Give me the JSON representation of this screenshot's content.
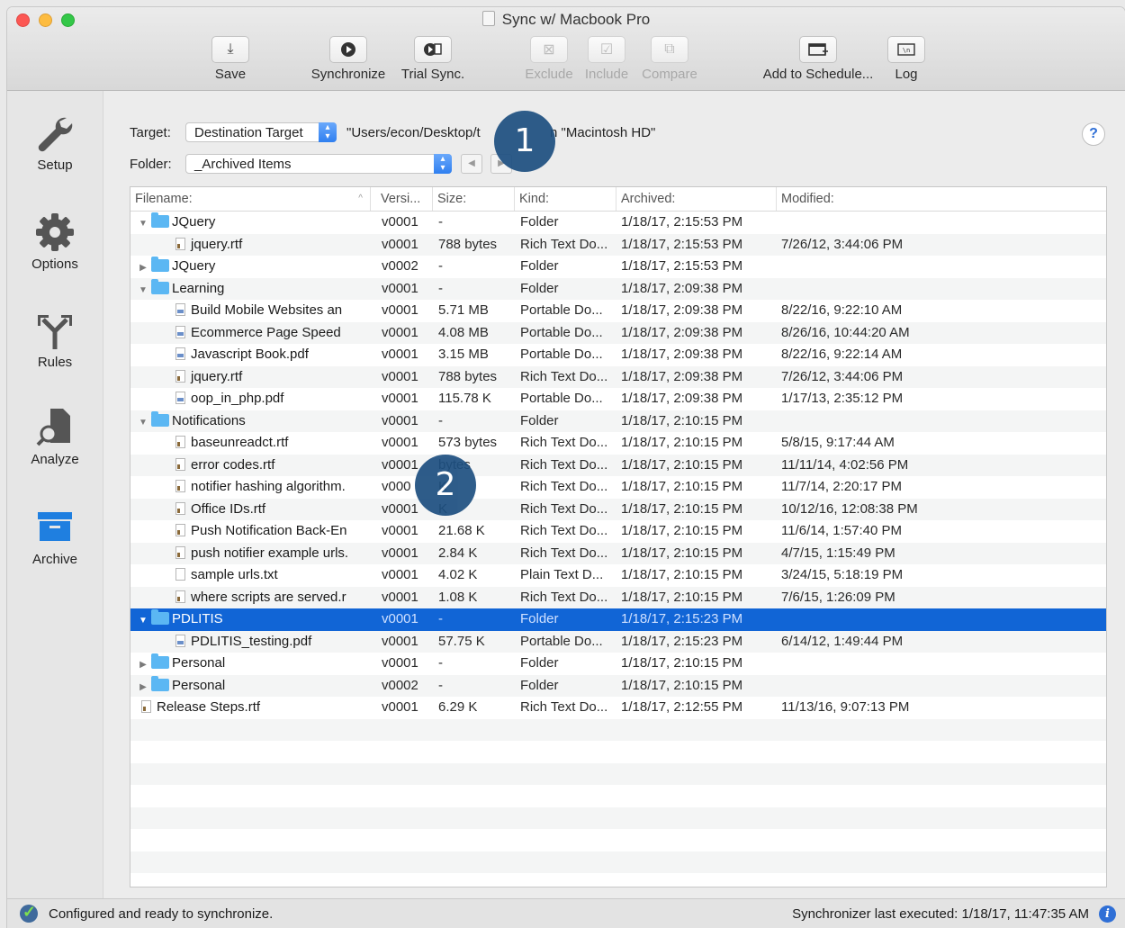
{
  "window": {
    "title": "Sync w/ Macbook Pro"
  },
  "toolbar": {
    "save": "Save",
    "synchronize": "Synchronize",
    "trial_sync": "Trial Sync.",
    "exclude": "Exclude",
    "include": "Include",
    "compare": "Compare",
    "add_schedule": "Add to Schedule...",
    "log": "Log"
  },
  "sidebar": {
    "setup": "Setup",
    "options": "Options",
    "rules": "Rules",
    "analyze": "Analyze",
    "archive": "Archive"
  },
  "controls": {
    "target_label": "Target:",
    "target_value": "Destination Target",
    "target_path": "\"Users/econ/Desktop/t",
    "target_volume": "n \"Macintosh HD\"",
    "folder_label": "Folder:",
    "folder_value": "_Archived Items",
    "help": "?"
  },
  "callouts": {
    "one": "1",
    "two": "2"
  },
  "table": {
    "headers": {
      "filename": "Filename:",
      "version": "Versi...",
      "size": "Size:",
      "kind": "Kind:",
      "archived": "Archived:",
      "modified": "Modified:"
    },
    "rows": [
      {
        "tri": "▼",
        "icon": "folder",
        "indent": 0,
        "name": "JQuery",
        "ver": "v0001",
        "size": "-",
        "kind": "Folder",
        "arch": "1/18/17, 2:15:53 PM",
        "mod": ""
      },
      {
        "tri": "",
        "icon": "rtf",
        "indent": 1,
        "name": "jquery.rtf",
        "ver": "v0001",
        "size": "788 bytes",
        "kind": "Rich Text Do...",
        "arch": "1/18/17, 2:15:53 PM",
        "mod": "7/26/12, 3:44:06 PM"
      },
      {
        "tri": "▶",
        "icon": "folder",
        "indent": 0,
        "name": "JQuery",
        "ver": "v0002",
        "size": "-",
        "kind": "Folder",
        "arch": "1/18/17, 2:15:53 PM",
        "mod": ""
      },
      {
        "tri": "▼",
        "icon": "folder",
        "indent": 0,
        "name": "Learning",
        "ver": "v0001",
        "size": "-",
        "kind": "Folder",
        "arch": "1/18/17, 2:09:38 PM",
        "mod": ""
      },
      {
        "tri": "",
        "icon": "pdf",
        "indent": 1,
        "name": "Build Mobile Websites an",
        "ver": "v0001",
        "size": "5.71 MB",
        "kind": "Portable Do...",
        "arch": "1/18/17, 2:09:38 PM",
        "mod": "8/22/16, 9:22:10 AM"
      },
      {
        "tri": "",
        "icon": "pdf",
        "indent": 1,
        "name": "Ecommerce Page Speed",
        "ver": "v0001",
        "size": "4.08 MB",
        "kind": "Portable Do...",
        "arch": "1/18/17, 2:09:38 PM",
        "mod": "8/26/16, 10:44:20 AM"
      },
      {
        "tri": "",
        "icon": "pdf",
        "indent": 1,
        "name": "Javascript Book.pdf",
        "ver": "v0001",
        "size": "3.15 MB",
        "kind": "Portable Do...",
        "arch": "1/18/17, 2:09:38 PM",
        "mod": "8/22/16, 9:22:14 AM"
      },
      {
        "tri": "",
        "icon": "rtf",
        "indent": 1,
        "name": "jquery.rtf",
        "ver": "v0001",
        "size": "788 bytes",
        "kind": "Rich Text Do...",
        "arch": "1/18/17, 2:09:38 PM",
        "mod": "7/26/12, 3:44:06 PM"
      },
      {
        "tri": "",
        "icon": "pdf",
        "indent": 1,
        "name": "oop_in_php.pdf",
        "ver": "v0001",
        "size": "115.78 K",
        "kind": "Portable Do...",
        "arch": "1/18/17, 2:09:38 PM",
        "mod": "1/17/13, 2:35:12 PM"
      },
      {
        "tri": "▼",
        "icon": "folder",
        "indent": 0,
        "name": "Notifications",
        "ver": "v0001",
        "size": "-",
        "kind": "Folder",
        "arch": "1/18/17, 2:10:15 PM",
        "mod": ""
      },
      {
        "tri": "",
        "icon": "rtf",
        "indent": 1,
        "name": "baseunreadct.rtf",
        "ver": "v0001",
        "size": "573 bytes",
        "kind": "Rich Text Do...",
        "arch": "1/18/17, 2:10:15 PM",
        "mod": "5/8/15, 9:17:44 AM"
      },
      {
        "tri": "",
        "icon": "rtf",
        "indent": 1,
        "name": "error codes.rtf",
        "ver": "v0001",
        "size": "bytes",
        "kind": "Rich Text Do...",
        "arch": "1/18/17, 2:10:15 PM",
        "mod": "11/11/14, 4:02:56 PM"
      },
      {
        "tri": "",
        "icon": "rtf",
        "indent": 1,
        "name": "notifier hashing algorithm.",
        "ver": "v000",
        "size": "K",
        "kind": "Rich Text Do...",
        "arch": "1/18/17, 2:10:15 PM",
        "mod": "11/7/14, 2:20:17 PM"
      },
      {
        "tri": "",
        "icon": "rtf",
        "indent": 1,
        "name": "Office IDs.rtf",
        "ver": "v0001",
        "size": "K",
        "kind": "Rich Text Do...",
        "arch": "1/18/17, 2:10:15 PM",
        "mod": "10/12/16, 12:08:38 PM"
      },
      {
        "tri": "",
        "icon": "rtf",
        "indent": 1,
        "name": "Push Notification Back-En",
        "ver": "v0001",
        "size": "21.68 K",
        "kind": "Rich Text Do...",
        "arch": "1/18/17, 2:10:15 PM",
        "mod": "11/6/14, 1:57:40 PM"
      },
      {
        "tri": "",
        "icon": "rtf",
        "indent": 1,
        "name": "push notifier example urls.",
        "ver": "v0001",
        "size": "2.84 K",
        "kind": "Rich Text Do...",
        "arch": "1/18/17, 2:10:15 PM",
        "mod": "4/7/15, 1:15:49 PM"
      },
      {
        "tri": "",
        "icon": "txt",
        "indent": 1,
        "name": "sample urls.txt",
        "ver": "v0001",
        "size": "4.02 K",
        "kind": "Plain Text D...",
        "arch": "1/18/17, 2:10:15 PM",
        "mod": "3/24/15, 5:18:19 PM"
      },
      {
        "tri": "",
        "icon": "rtf",
        "indent": 1,
        "name": "where scripts are served.r",
        "ver": "v0001",
        "size": "1.08 K",
        "kind": "Rich Text Do...",
        "arch": "1/18/17, 2:10:15 PM",
        "mod": "7/6/15, 1:26:09 PM"
      },
      {
        "tri": "▼",
        "icon": "folder",
        "indent": 0,
        "name": "PDLITIS",
        "ver": "v0001",
        "size": "-",
        "kind": "Folder",
        "arch": "1/18/17, 2:15:23 PM",
        "mod": "",
        "selected": true
      },
      {
        "tri": "",
        "icon": "pdf",
        "indent": 1,
        "name": "PDLITIS_testing.pdf",
        "ver": "v0001",
        "size": "57.75 K",
        "kind": "Portable Do...",
        "arch": "1/18/17, 2:15:23 PM",
        "mod": "6/14/12, 1:49:44 PM"
      },
      {
        "tri": "▶",
        "icon": "folder",
        "indent": 0,
        "name": "Personal",
        "ver": "v0001",
        "size": "-",
        "kind": "Folder",
        "arch": "1/18/17, 2:10:15 PM",
        "mod": ""
      },
      {
        "tri": "▶",
        "icon": "folder",
        "indent": 0,
        "name": "Personal",
        "ver": "v0002",
        "size": "-",
        "kind": "Folder",
        "arch": "1/18/17, 2:10:15 PM",
        "mod": ""
      },
      {
        "tri": "",
        "icon": "rtf",
        "indent": 0,
        "name": "Release Steps.rtf",
        "ver": "v0001",
        "size": "6.29 K",
        "kind": "Rich Text Do...",
        "arch": "1/18/17, 2:12:55 PM",
        "mod": "11/13/16, 9:07:13 PM"
      }
    ],
    "empty_rows": 8
  },
  "status": {
    "message": "Configured and ready to synchronize.",
    "last_executed": "Synchronizer last executed:  1/18/17, 11:47:35 AM",
    "info": "i"
  },
  "colors": {
    "selection": "#1165d6",
    "folder": "#5bb7f3",
    "callout": "#1d4f80"
  }
}
